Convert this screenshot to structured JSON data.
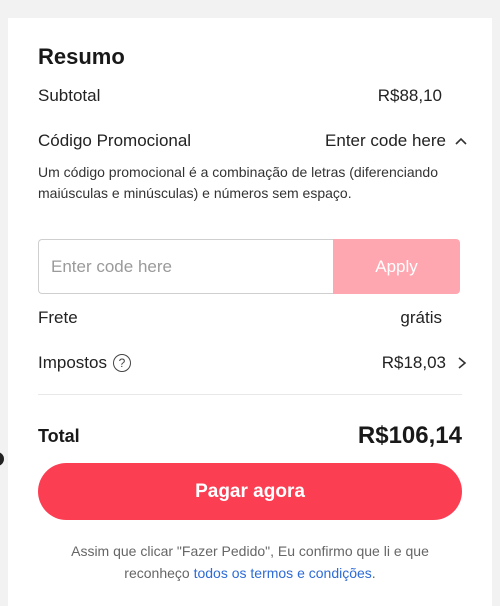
{
  "summary": {
    "title": "Resumo",
    "subtotal_label": "Subtotal",
    "subtotal_value": "R$88,10",
    "promo_label": "Código Promocional",
    "promo_toggle_label": "Enter code here",
    "promo_help": "Um código promocional é a combinação de letras (diferenciando maiúsculas e minúsculas) e números sem espaço.",
    "promo_input_placeholder": "Enter code here",
    "apply_label": "Apply",
    "frete_label": "Frete",
    "frete_value": "grátis",
    "tax_label": "Impostos",
    "tax_value": "R$18,03",
    "total_label": "Total",
    "total_value": "R$106,14",
    "pay_label": "Pagar agora",
    "terms_text": "Assim que clicar \"Fazer Pedido\", Eu confirmo que li e que reconheço ",
    "terms_link": "todos os termos e condições",
    "terms_end": "."
  },
  "colors": {
    "pay_button": "#fc3e53",
    "apply_button_disabled": "#ffa7b0",
    "link": "#2e6bd6"
  },
  "icons": {
    "help": "question-circle-icon",
    "collapse": "chevron-up-icon",
    "expand": "chevron-right-icon"
  }
}
